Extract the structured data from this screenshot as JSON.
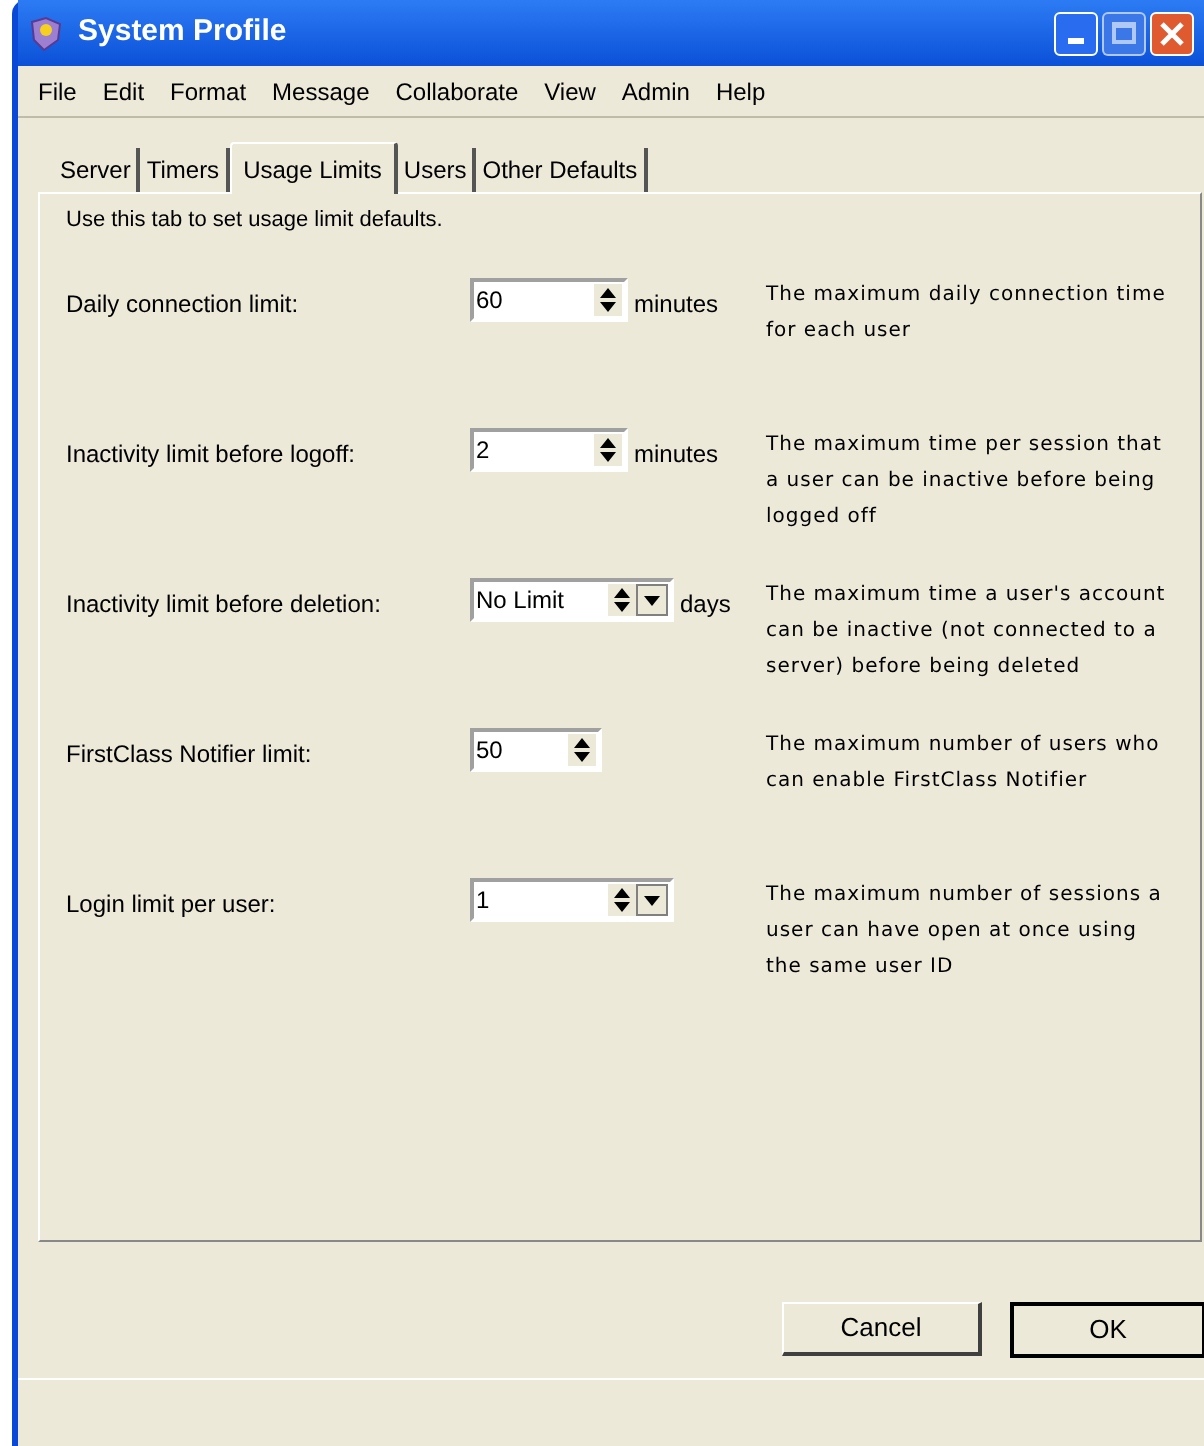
{
  "window": {
    "title": "System Profile"
  },
  "menu": [
    "File",
    "Edit",
    "Format",
    "Message",
    "Collaborate",
    "View",
    "Admin",
    "Help"
  ],
  "tabs": [
    {
      "label": "Server",
      "selected": false
    },
    {
      "label": "Timers",
      "selected": false
    },
    {
      "label": "Usage Limits",
      "selected": true
    },
    {
      "label": "Users",
      "selected": false
    },
    {
      "label": "Other Defaults",
      "selected": false
    }
  ],
  "intro": "Use this tab to set usage limit defaults.",
  "rows": [
    {
      "label": "Daily connection limit:",
      "value": "60",
      "kind": "spinner",
      "unit": "minutes",
      "description": "The maximum daily connection time for each user"
    },
    {
      "label": "Inactivity limit before logoff:",
      "value": "2",
      "kind": "spinner",
      "unit": "minutes",
      "description": "The maximum time per session that a user can be inactive before being logged off"
    },
    {
      "label": "Inactivity limit before deletion:",
      "value": "No Limit",
      "kind": "spinner-dropdown",
      "unit": "days",
      "description": "The maximum time a user's account can be inactive (not connected to a server) before being deleted"
    },
    {
      "label": "FirstClass Notifier limit:",
      "value": "50",
      "kind": "spinner-short",
      "description": "The maximum number of users who can enable FirstClass Notifier"
    },
    {
      "label": "Login limit per user:",
      "value": "1",
      "kind": "spinner-dropdown",
      "description": "The maximum number of sessions a user can have open at once using the same user ID"
    }
  ],
  "buttons": [
    {
      "label": "Cancel",
      "default": false
    },
    {
      "label": "OK",
      "default": true
    }
  ]
}
